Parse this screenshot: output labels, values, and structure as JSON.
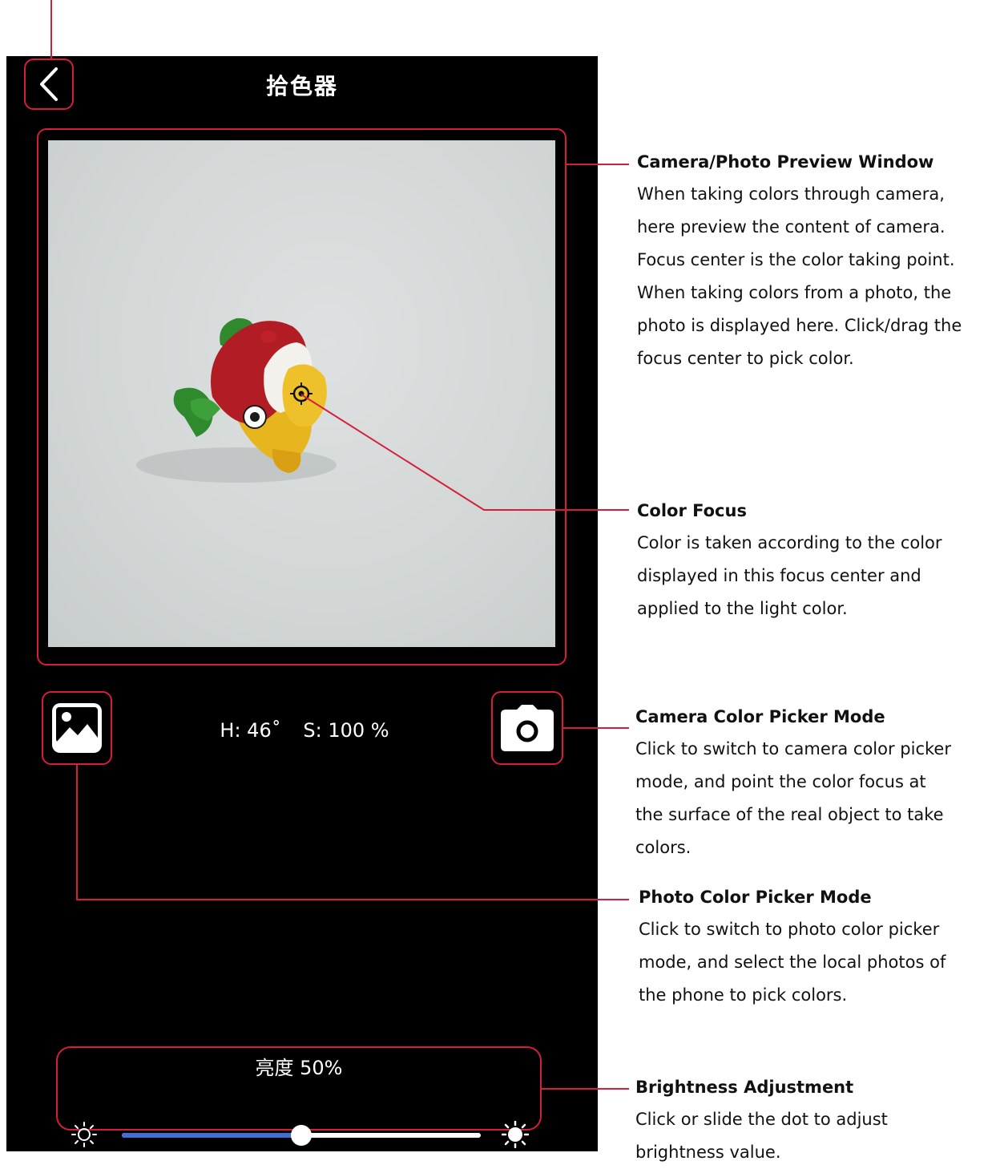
{
  "header": {
    "title": "拾色器",
    "back_icon": "chevron-left-icon"
  },
  "preview": {
    "focus_icon": "crosshair-target-icon"
  },
  "readout": {
    "hue": "H: 46˚",
    "saturation": "S: 100 %"
  },
  "mode_buttons": {
    "photo_icon": "image-icon",
    "camera_icon": "camera-icon"
  },
  "brightness": {
    "label": "亮度 50%",
    "value": 0.5,
    "min_icon": "sun-outline-icon",
    "max_icon": "sun-filled-icon"
  },
  "annotations": [
    {
      "title": "Camera/Photo Preview Window",
      "lines": [
        "When taking colors through camera,",
        "here preview the content of camera.",
        "Focus center is the color taking point.",
        "When taking colors from a photo, the",
        "photo is displayed here. Click/drag the",
        "focus center to pick color."
      ]
    },
    {
      "title": "Color Focus",
      "lines": [
        "Color is taken according to the color",
        "displayed in this focus center and",
        "applied to the light color."
      ]
    },
    {
      "title": "Camera Color Picker Mode",
      "lines": [
        "Click to switch to camera color picker",
        "mode, and point the color focus at",
        "the surface of the real object to take",
        "colors."
      ]
    },
    {
      "title": "Photo Color Picker Mode",
      "lines": [
        "Click to switch to photo color picker",
        "mode, and select the local photos of",
        "the phone to pick colors."
      ]
    },
    {
      "title": "Brightness Adjustment",
      "lines": [
        "Click or slide the dot to adjust",
        "brightness value."
      ]
    }
  ],
  "colors": {
    "annotation_red": "#d61e3c",
    "slider_blue": "#3f6ed6",
    "phone_bg": "#000000"
  }
}
